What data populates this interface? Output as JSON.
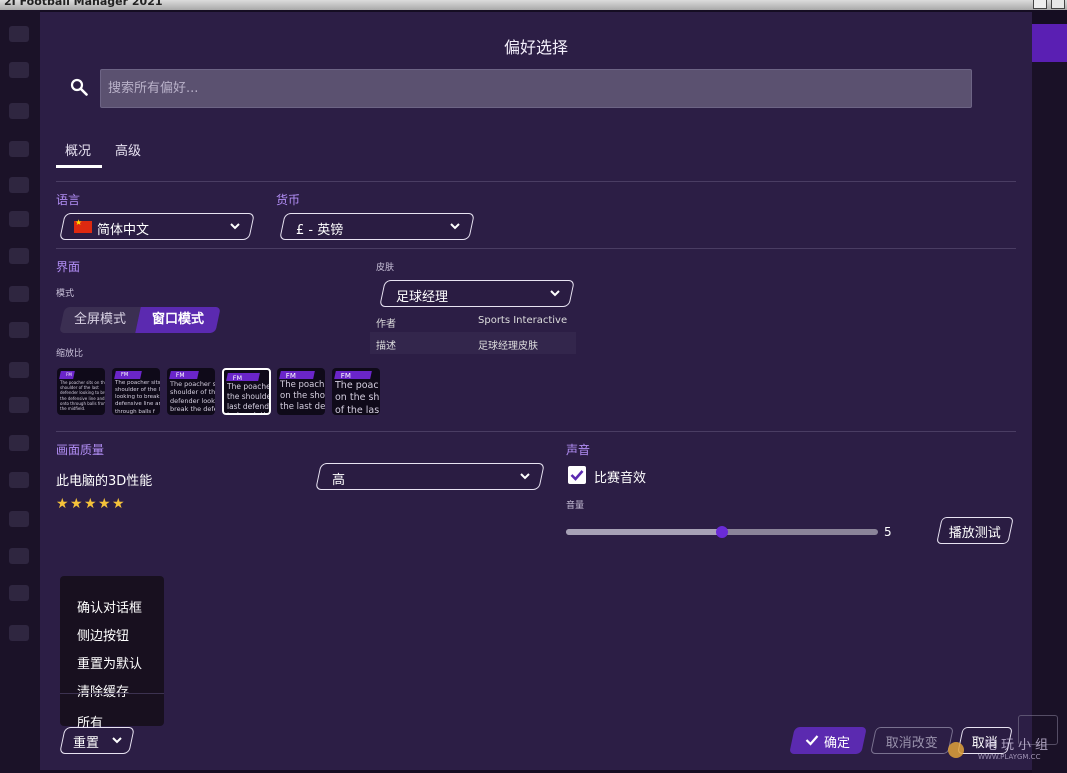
{
  "window": {
    "title": "2I Football Manager 2021"
  },
  "dialog": {
    "title": "偏好选择",
    "search": {
      "placeholder": "搜索所有偏好..."
    },
    "tabs": [
      {
        "label": "概况",
        "active": true
      },
      {
        "label": "高级",
        "active": false
      }
    ],
    "language": {
      "label": "语言",
      "value": "简体中文",
      "flag": "china-flag"
    },
    "currency": {
      "label": "货币",
      "value": "£ - 英镑"
    },
    "interface": {
      "label": "界面",
      "mode_label": "模式",
      "modes": [
        {
          "label": "全屏模式",
          "selected": false
        },
        {
          "label": "窗口模式",
          "selected": true
        }
      ],
      "zoom_label": "缩放比",
      "zoom_selected_index": 3,
      "zoom_previews": [
        {
          "header": "FM",
          "text": "The poacher sits on the\nshoulder of the last\ndefender looking to break\nthe defensive line and\nonto through balls from\nthe midfield."
        },
        {
          "header": "FM",
          "text": "The poacher sits\nshoulder of the l\nlooking to break\ndefensive line an\nthrough balls f"
        },
        {
          "header": "FM",
          "text": "The poacher s\nshoulder of th\ndefender look\nbreak the defe"
        },
        {
          "header": "FM",
          "text": "The poache\nthe shoulde\nlast defend\nto break th"
        },
        {
          "header": "FM",
          "text": "The poach\non the sho\nthe last de"
        },
        {
          "header": "FM",
          "text": "The poac\non the sh\nof the las"
        }
      ]
    },
    "skin": {
      "label": "皮肤",
      "value": "足球经理",
      "author_label": "作者",
      "author": "Sports Interactive",
      "desc_label": "描述",
      "desc": "足球经理皮肤"
    },
    "graphics": {
      "label": "画面质量",
      "perf_label": "此电脑的3D性能",
      "rating": 5,
      "stars": [
        "★",
        "★",
        "★",
        "★",
        "★"
      ],
      "quality": "高"
    },
    "sound": {
      "label": "声音",
      "match_sfx_label": "比赛音效",
      "match_sfx_checked": true,
      "volume_label": "音量",
      "volume": 5,
      "volume_max": 10,
      "test_button": "播放测试"
    },
    "reset_menu": {
      "items": [
        "确认对话框",
        "侧边按钮",
        "重置为默认",
        "清除缓存"
      ],
      "all": "所有"
    },
    "footer": {
      "reset": "重置",
      "ok": "确定",
      "revert": "取消改变",
      "cancel": "取消"
    }
  },
  "watermark": {
    "text": "电玩小组",
    "url": "WWW.PLAYGM.CC"
  },
  "colors": {
    "accent": "#5b2ab0",
    "section": "#b28ef5",
    "dialog_bg": "#2c1e45",
    "star": "#f5c23a"
  }
}
